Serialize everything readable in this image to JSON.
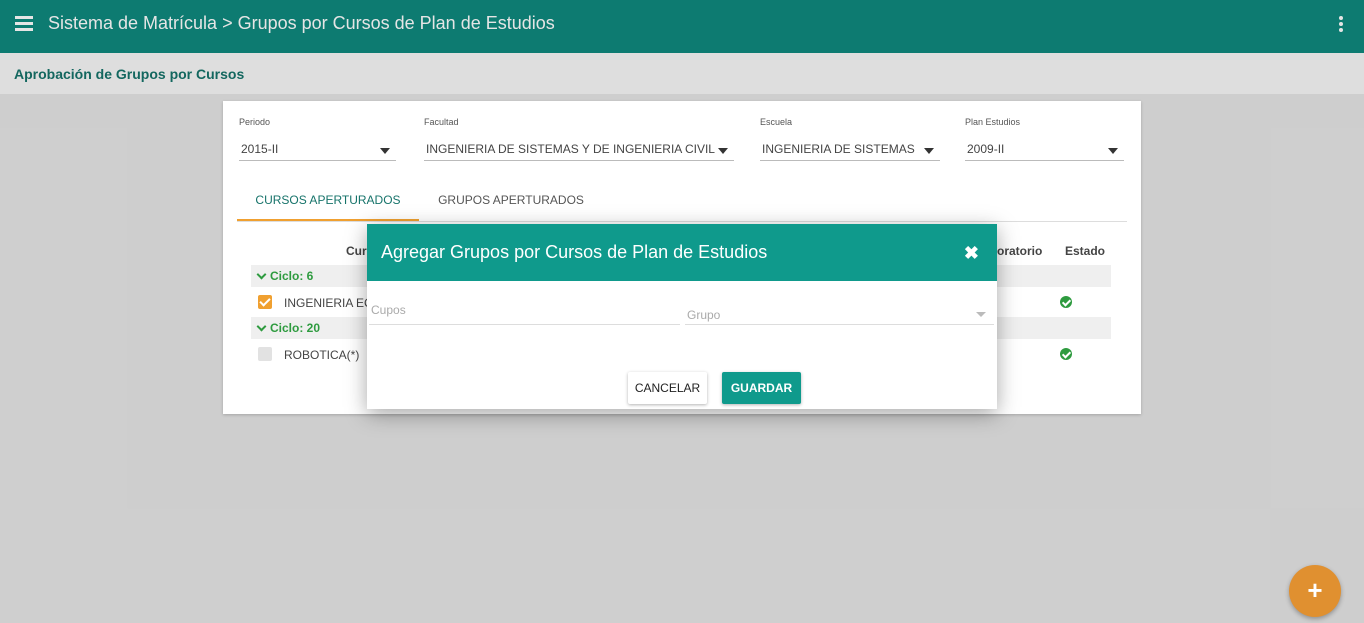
{
  "header": {
    "title": "Sistema de Matrícula > Grupos por Cursos de Plan de Estudios",
    "menu_icon": "menu-icon",
    "more_icon": "more-vert-icon"
  },
  "subheader": {
    "title": "Aprobación de Grupos por Cursos"
  },
  "filters": {
    "periodo": {
      "label": "Periodo",
      "value": "2015-II"
    },
    "facultad": {
      "label": "Facultad",
      "value": "INGENIERIA DE SISTEMAS Y DE INGENIERIA CIVIL"
    },
    "escuela": {
      "label": "Escuela",
      "value": "INGENIERIA DE SISTEMAS"
    },
    "plan": {
      "label": "Plan Estudios",
      "value": "2009-II"
    }
  },
  "tabs": [
    {
      "label": "CURSOS APERTURADOS",
      "active": true
    },
    {
      "label": "GRUPOS APERTURADOS",
      "active": false
    }
  ],
  "table": {
    "headers": {
      "curso": "Cur",
      "laboratorio": "oratorio",
      "estado": "Estado"
    },
    "groups": [
      {
        "label": "Ciclo: 6",
        "course": "INGENIERIA EC",
        "checked": true,
        "status_icon": "check-circle-icon"
      },
      {
        "label": "Ciclo: 20",
        "course": "ROBOTICA(*)",
        "checked": false,
        "status_icon": "check-circle-icon"
      }
    ]
  },
  "modal": {
    "title": "Agregar Grupos por Cursos de Plan de Estudios",
    "close_icon": "close-icon",
    "close_glyph": "✖",
    "cupos_placeholder": "Cupos",
    "grupo_placeholder": "Grupo",
    "cancel_label": "CANCELAR",
    "save_label": "GUARDAR"
  },
  "fab": {
    "glyph": "+",
    "icon": "add-icon"
  },
  "colors": {
    "primary": "#0f8a7e",
    "accent": "#f0a030",
    "success": "#2e9b3f"
  }
}
